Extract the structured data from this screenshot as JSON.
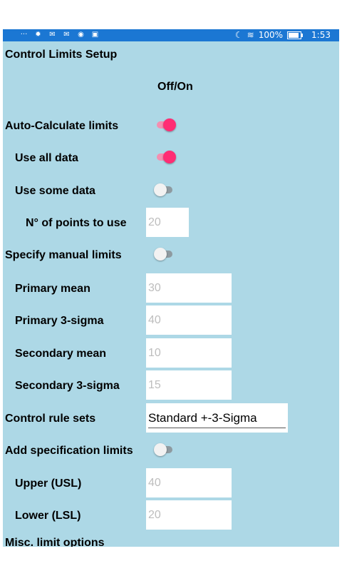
{
  "status": {
    "icons": [
      "more-icon",
      "settings-icon",
      "mail-icon",
      "mail-icon",
      "shield-icon",
      "amazon-icon"
    ],
    "battery": "100%",
    "time": "1:53"
  },
  "screen": {
    "title": "Control Limits Setup",
    "column_header": "Off/On"
  },
  "rows": {
    "auto_calc": {
      "label": "Auto-Calculate limits",
      "on": true
    },
    "use_all": {
      "label": "Use all data",
      "on": true
    },
    "use_some": {
      "label": "Use some data",
      "on": false
    },
    "points": {
      "label": "N° of points to use",
      "placeholder": "20"
    },
    "manual": {
      "label": "Specify manual limits",
      "on": false
    },
    "primary_mean": {
      "label": "Primary mean",
      "placeholder": "30"
    },
    "primary_sigma": {
      "label": "Primary 3-sigma",
      "placeholder": "40"
    },
    "secondary_mean": {
      "label": "Secondary mean",
      "placeholder": "10"
    },
    "secondary_sigma": {
      "label": "Secondary 3-sigma",
      "placeholder": "15"
    },
    "rule_sets": {
      "label": "Control rule sets",
      "value": "Standard +-3-Sigma"
    },
    "spec_limits": {
      "label": "Add specification limits",
      "on": false
    },
    "usl": {
      "label": "Upper (USL)",
      "placeholder": "40"
    },
    "lsl": {
      "label": "Lower (LSL)",
      "placeholder": "20"
    },
    "misc": {
      "label": "Misc. limit options"
    }
  },
  "colors": {
    "status_bar": "#1b77d3",
    "background": "#add8e6",
    "switch_on": "#ff2d74"
  }
}
